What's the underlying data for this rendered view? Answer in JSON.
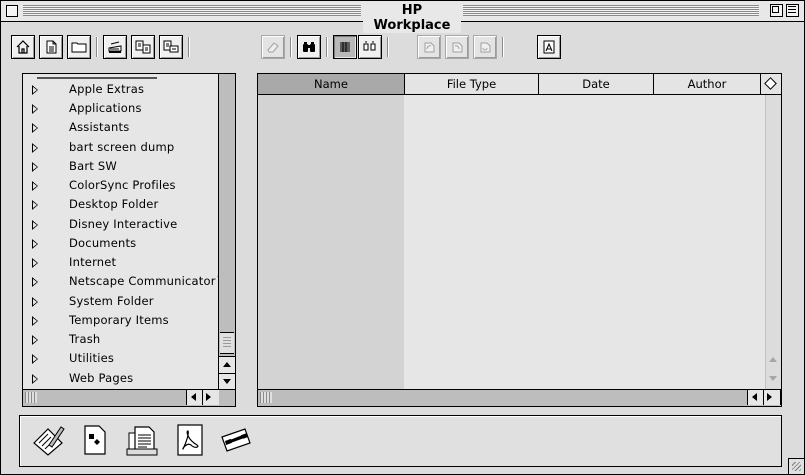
{
  "window": {
    "title": "HP Workplace"
  },
  "toolbar": {
    "buttons": [
      {
        "icon": "home-icon"
      },
      {
        "icon": "document-icon"
      },
      {
        "icon": "folder-icon"
      },
      {
        "icon": "scanner-icon"
      },
      {
        "icon": "copy-to-fax-icon"
      },
      {
        "icon": "copy-to-printer-icon"
      },
      {
        "icon": "eraser-icon",
        "state": "disabled"
      },
      {
        "icon": "binoculars-icon"
      },
      {
        "icon": "list-view-icon",
        "state": "pressed"
      },
      {
        "icon": "thumbnail-view-icon"
      },
      {
        "icon": "rotate-left-icon",
        "state": "disabled"
      },
      {
        "icon": "rotate-right-icon",
        "state": "disabled"
      },
      {
        "icon": "rotate-180-icon",
        "state": "disabled"
      },
      {
        "icon": "text-recognition-icon"
      }
    ]
  },
  "tree": {
    "items": [
      "Apple Extras",
      "Applications",
      "Assistants",
      "bart screen dump",
      "Bart SW",
      "ColorSync Profiles",
      "Desktop Folder",
      "Disney Interactive",
      "Documents",
      "Internet",
      "Netscape Communicator™",
      "System Folder",
      "Temporary Items",
      "Trash",
      "Utilities",
      "Web Pages"
    ]
  },
  "list": {
    "columns": [
      "",
      "Name",
      "File Type",
      "Date",
      "Author"
    ]
  },
  "tray": {
    "items": [
      {
        "icon": "pen-document-icon"
      },
      {
        "icon": "document-shapes-icon"
      },
      {
        "icon": "text-documents-stack-icon"
      },
      {
        "icon": "acrobat-document-icon"
      },
      {
        "icon": "email-document-icon"
      }
    ]
  },
  "colors": {
    "window_bg": "#dcdcdc",
    "pane_bg": "#e6e6e6",
    "sorted_column": "#a9a9a9"
  }
}
